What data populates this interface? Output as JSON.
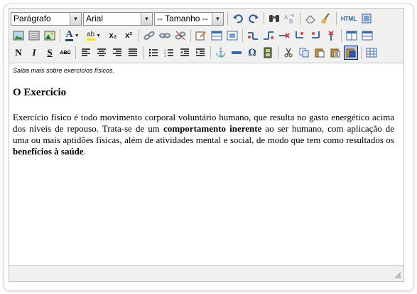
{
  "toolbar": {
    "format_select": "Parágrafo",
    "font_select": "Arial",
    "size_select": "-- Tamanho --",
    "html_label": "HTML",
    "bold_label": "N",
    "italic_label": "I",
    "underline_label": "S",
    "strike_label": "ABC",
    "text_color_label": "A",
    "highlight_label": "ab",
    "subscript_label": "x₂",
    "superscript_label": "x²",
    "anchor_label": "⚓",
    "omega_label": "Ω"
  },
  "content": {
    "caption": "Saiba mais sobre exercícios físicos.",
    "heading": "O Exercício",
    "paragraph": {
      "part1": "Exercício físico é todo movimento corporal voluntário humano, que resulta no gasto energético acima dos níveis de repouso. Trata-se de um ",
      "bold1": "comportamento inerente",
      "part2": " ao ser humano, com aplicação de uma ou mais aptidões físicas, além de atividades mental e social, de modo que tem como resultados os ",
      "bold2": "benefícios à saúde",
      "part3": "."
    }
  },
  "colors": {
    "toolbar_bg": "#f0f0ee",
    "icon_blue": "#1f4f8a",
    "active_bg": "#b6c6df"
  }
}
